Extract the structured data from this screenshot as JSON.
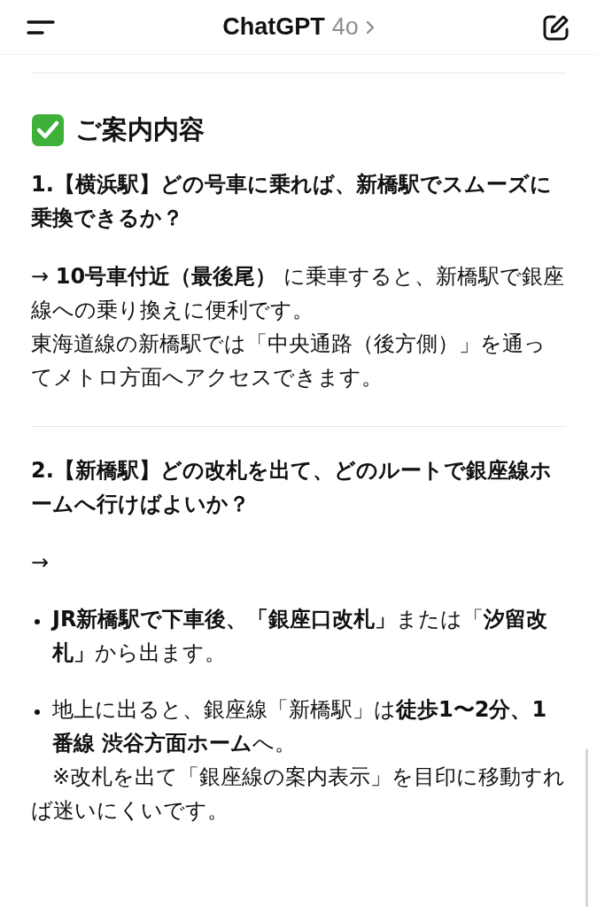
{
  "header": {
    "title": "ChatGPT",
    "model": "4o"
  },
  "section_title": "ご案内内容",
  "blocks": [
    {
      "kind": "heading",
      "text": "1.【横浜駅】どの号車に乗れば、新橋駅でスムーズに乗換できるか？"
    },
    {
      "kind": "paragraph",
      "text": "→ **10号車付近（最後尾）** に乗車すると、新橋駅で銀座線への乗り換えに便利です。"
    },
    {
      "kind": "line",
      "text": "東海道線の新橋駅では「中央通路（後方側）」を通ってメトロ方面へアクセスできます。"
    },
    {
      "kind": "divider"
    },
    {
      "kind": "heading",
      "text": "2.【新橋駅】どの改札を出て、どのルートで銀座線ホームへ行けばよいか？"
    },
    {
      "kind": "paragraph",
      "text": "→"
    },
    {
      "kind": "bullet",
      "text": "**JR新橋駅で下車後、「銀座口改札」**または「**汐留改札」**から出ます。"
    },
    {
      "kind": "bullet",
      "text": "地上に出ると、銀座線「新橋駅」は**徒歩1〜2分、1番線 渋谷方面ホーム**へ。"
    },
    {
      "kind": "note",
      "text": "　※改札を出て「銀座線の案内表示」を目印に移動すれば迷いにくいです。"
    }
  ]
}
